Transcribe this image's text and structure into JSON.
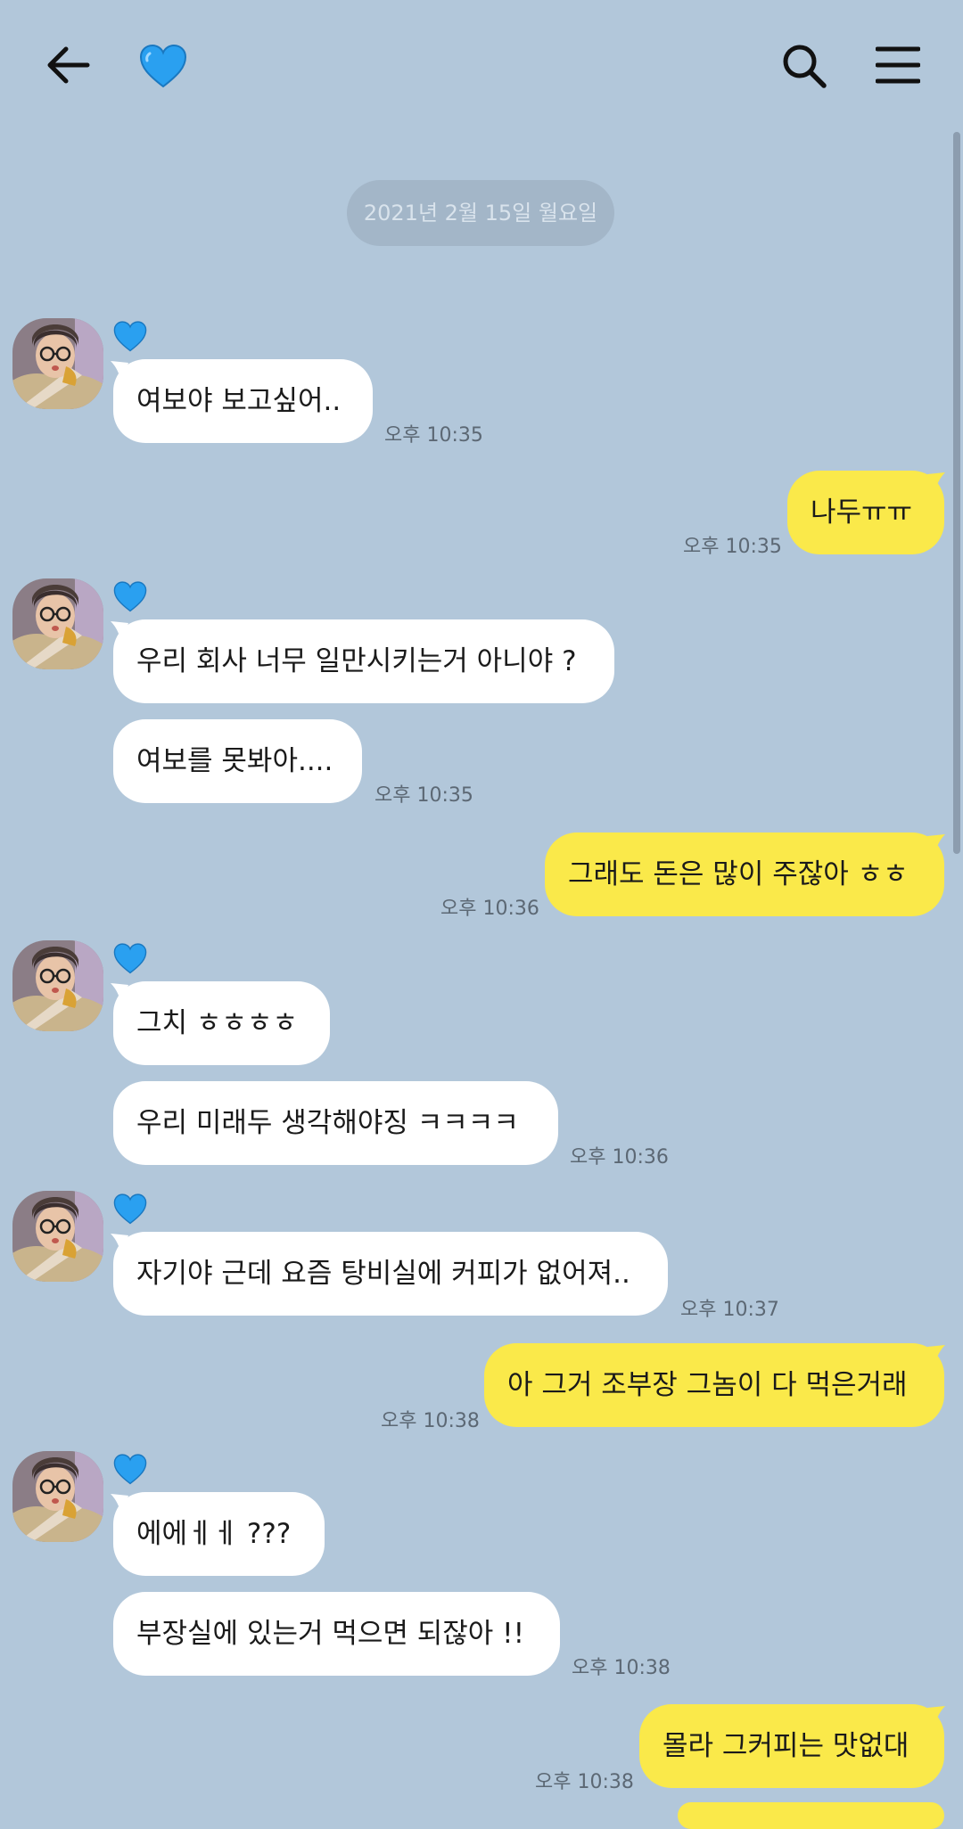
{
  "header": {
    "back_icon": "arrow-left-icon",
    "chat_title_icon": "blue-heart-icon",
    "search_icon": "search-icon",
    "menu_icon": "hamburger-menu-icon"
  },
  "date_divider": "2021년 2월 15일 월요일",
  "colors": {
    "background": "#b2c7da",
    "incoming_bubble": "#ffffff",
    "outgoing_bubble": "#fae94a",
    "heart": "#2aa0f0"
  },
  "messages": [
    {
      "side": "in",
      "text": "여보야 보고싶어..",
      "time": "오후 10:35"
    },
    {
      "side": "out",
      "text": "나두ㅠㅠ",
      "time": "오후 10:35"
    },
    {
      "side": "in",
      "text": "우리 회사 너무 일만시키는거 아니야 ?",
      "time": ""
    },
    {
      "side": "in",
      "text": "여보를 못봐아....",
      "time": "오후 10:35"
    },
    {
      "side": "out",
      "text": "그래도 돈은 많이 주잖아 ㅎㅎ",
      "time": "오후 10:36"
    },
    {
      "side": "in",
      "text": "그치 ㅎㅎㅎㅎ",
      "time": ""
    },
    {
      "side": "in",
      "text": "우리 미래두 생각해야징 ㅋㅋㅋㅋ",
      "time": "오후 10:36"
    },
    {
      "side": "in",
      "text": "자기야 근데 요즘 탕비실에 커피가 없어져..",
      "time": "오후 10:37"
    },
    {
      "side": "out",
      "text": "아 그거 조부장 그놈이 다 먹은거래",
      "time": "오후 10:38"
    },
    {
      "side": "in",
      "text": "에에ㅔㅔ ???",
      "time": ""
    },
    {
      "side": "in",
      "text": "부장실에 있는거 먹으면 되잖아 !!",
      "time": "오후 10:38"
    },
    {
      "side": "out",
      "text": "몰라 그커피는 맛없대",
      "time": "오후 10:38"
    }
  ]
}
